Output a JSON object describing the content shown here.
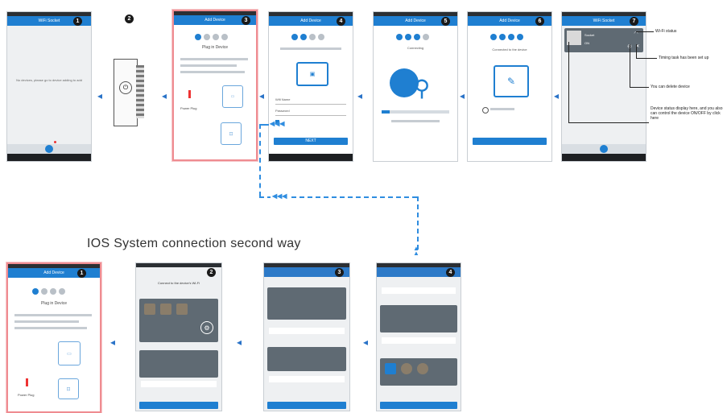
{
  "section_title": "IOS System connection second way",
  "top_row": {
    "step_badges": [
      "1",
      "2",
      "3",
      "4",
      "5",
      "6",
      "7"
    ],
    "screen1": {
      "header": "WiFi Socket",
      "empty_text": "No devices, please go to device adding to add"
    },
    "screen3": {
      "header": "Add Device",
      "step_title": "Plug in Device",
      "power_label": "Power Plug"
    },
    "screen4": {
      "header": "Add Device",
      "field1": "Wifi Name",
      "field2": "Password",
      "next_label": "NEXT"
    },
    "screen5": {
      "header": "Add Device",
      "status": "Connecting"
    },
    "screen6": {
      "header": "Add Device",
      "status": "Connected to the device"
    },
    "screen7": {
      "header": "WiFi Socket",
      "device_name": "Socket",
      "device_state": "ON"
    }
  },
  "annotations": [
    "Wi-Fi status",
    "Timing task has been set up",
    "You can delete device",
    "Device status display here, and you also can control the device ON/OFF by click here"
  ],
  "bottom_row": {
    "step_badges": [
      "1",
      "2",
      "3",
      "4"
    ],
    "screen1": {
      "header": "Add Device",
      "step_title": "Plug in Device",
      "power_label": "Power Plug"
    },
    "screen2": {
      "title": "Connect to the device's Wi-Fi"
    }
  },
  "colors": {
    "accent": "#1f7fd1",
    "highlight": "#ef8c91",
    "dashed": "#2f8de0"
  }
}
